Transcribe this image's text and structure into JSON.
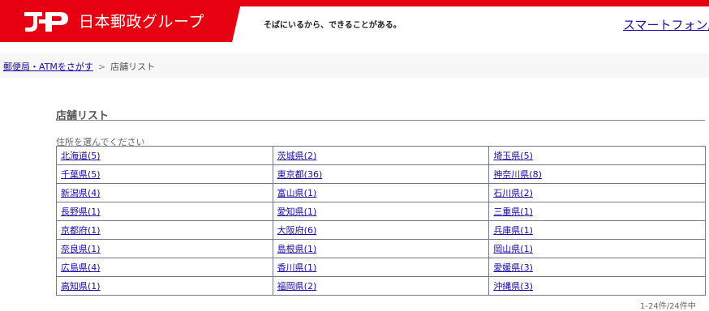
{
  "header": {
    "logo_text": "日本郵政グループ",
    "tagline": "そばにいるから、できることがある。",
    "smartphone_link": "スマートフォン版",
    "brand_color": "#e60012"
  },
  "breadcrumb": {
    "home_link": "郵便局・ATMをさがす",
    "separator": ">",
    "current": "店舗リスト"
  },
  "section": {
    "title": "店舗リスト",
    "instruction": "住所を選んでください"
  },
  "prefectures": [
    [
      "北海道(5)",
      "茨城県(2)",
      "埼玉県(5)"
    ],
    [
      "千葉県(5)",
      "東京都(36)",
      "神奈川県(8)"
    ],
    [
      "新潟県(4)",
      "富山県(1)",
      "石川県(2)"
    ],
    [
      "長野県(1)",
      "愛知県(1)",
      "三重県(1)"
    ],
    [
      "京都府(1)",
      "大阪府(6)",
      "兵庫県(1)"
    ],
    [
      "奈良県(1)",
      "島根県(1)",
      "岡山県(1)"
    ],
    [
      "広島県(4)",
      "香川県(1)",
      "愛媛県(3)"
    ],
    [
      "高知県(1)",
      "福岡県(2)",
      "沖縄県(3)"
    ]
  ],
  "result_count": "1-24件/24件中"
}
